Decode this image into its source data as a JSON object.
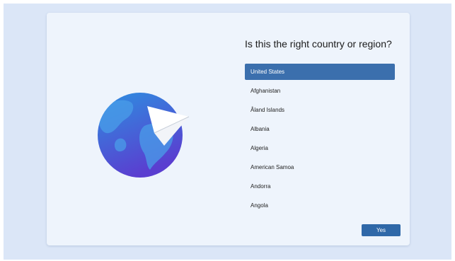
{
  "setup": {
    "question": "Is this the right country or region?",
    "countries": [
      "United States",
      "Afghanistan",
      "Åland Islands",
      "Albania",
      "Algeria",
      "American Samoa",
      "Andorra",
      "Angola"
    ],
    "selected_country": "United States",
    "yes_label": "Yes"
  },
  "illustration": {
    "icon": "globe-with-paper-plane-icon"
  },
  "colors": {
    "background": "#dbe6f7",
    "card": "#eef4fc",
    "accent": "#3b6fad",
    "globe_top": "#2d8fe0",
    "globe_bottom": "#5a3ed0",
    "land": "#4a9ee8"
  }
}
